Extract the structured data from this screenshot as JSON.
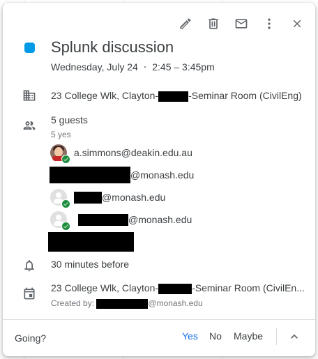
{
  "toolbar": {
    "icons": [
      "edit-icon",
      "delete-icon",
      "email-icon",
      "more-options-icon",
      "close-icon"
    ]
  },
  "event": {
    "color": "#039be5",
    "title": "Splunk discussion",
    "date": "Wednesday, July 24",
    "separator": "⋅",
    "time": "2:45 – 3:45pm"
  },
  "location": {
    "prefix": "23 College Wlk, Clayton-",
    "suffix": "-Seminar Room (CivilEng)"
  },
  "guests": {
    "count_label": "5 guests",
    "summary": "5 yes",
    "list": [
      {
        "text": "a.simmons@deakin.edu.au"
      },
      {
        "text": "@monash.edu"
      },
      {
        "text": "@monash.edu"
      },
      {
        "text": "@monash.edu"
      },
      {
        "text": ""
      }
    ]
  },
  "reminder": {
    "text": "30 minutes before"
  },
  "calendar": {
    "location_prefix": "23 College Wlk, Clayton-",
    "location_suffix": "-Seminar Room (CivilEn...",
    "created_by_label": "Created by:",
    "created_by_suffix": "@monash.edu"
  },
  "footer": {
    "going_label": "Going?",
    "yes_label": "Yes",
    "no_label": "No",
    "maybe_label": "Maybe",
    "selected": "Yes"
  },
  "colors": {
    "accent": "#1a73e8",
    "event_color": "#039be5",
    "check_green": "#1e8e3e"
  }
}
